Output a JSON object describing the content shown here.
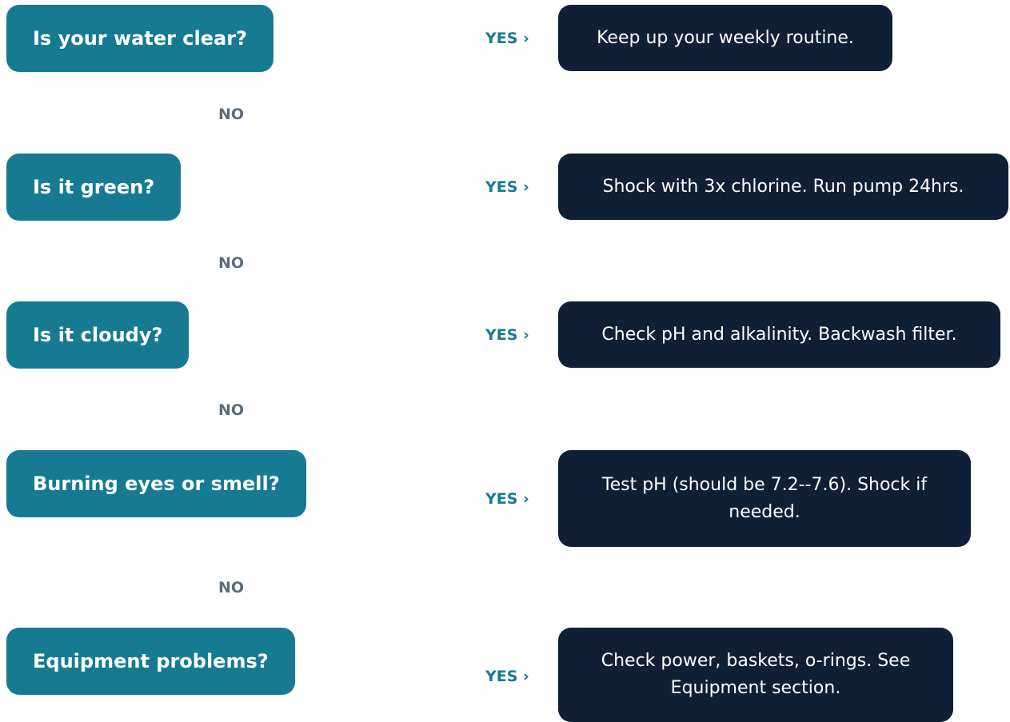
{
  "steps": [
    {
      "question": "Is your water clear?",
      "yes_label": "YES ›",
      "answer": "Keep up your weekly routine.",
      "no_label": "NO"
    },
    {
      "question": "Is it green?",
      "yes_label": "YES ›",
      "answer": "Shock with 3x chlorine. Run pump 24hrs.",
      "no_label": "NO"
    },
    {
      "question": "Is it cloudy?",
      "yes_label": "YES ›",
      "answer": "Check pH and alkalinity. Backwash filter.",
      "no_label": "NO"
    },
    {
      "question": "Burning eyes or smell?",
      "yes_label": "YES ›",
      "answer": "Test pH (should be 7.2--7.6). Shock if needed.",
      "no_label": "NO"
    },
    {
      "question": "Equipment problems?",
      "yes_label": "YES ›",
      "answer": "Check power, baskets, o-rings. See Equipment section."
    }
  ],
  "colors": {
    "question_fill": "#167a93",
    "answer_fill": "#0f1f36",
    "yes_text": "#167a93",
    "no_text": "#5d6b7d"
  }
}
